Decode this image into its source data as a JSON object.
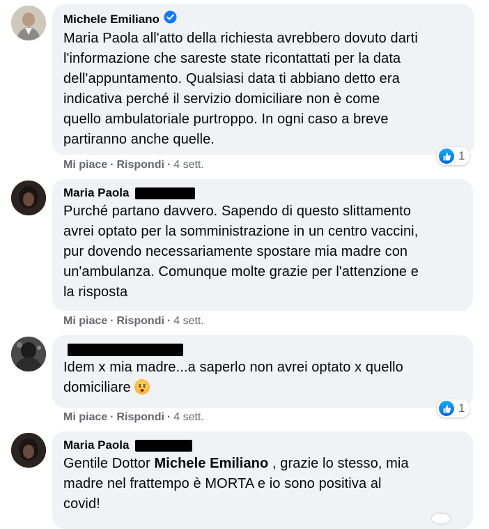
{
  "comments": [
    {
      "author": "Michele Emiliano",
      "verified": true,
      "lines": [
        "Maria Paola all'atto della richiesta avrebbero dovuto darti",
        "l'informazione che sareste state ricontattati per la data",
        "dell'appuntamento. Qualsiasi data ti abbiano detto era",
        "indicativa perché il servizio domiciliare non è come",
        "quello ambulatoriale purtroppo. In ogni caso a breve",
        "partiranno anche quelle."
      ],
      "like_label": "Mi piace",
      "reply_label": "Rispondi",
      "time": "4 sett.",
      "reaction_count": "1"
    },
    {
      "author": "Maria Paola",
      "lines": [
        "Purché partano davvero. Sapendo di questo slittamento",
        "avrei optato per la somministrazione in un centro vaccini,",
        "pur dovendo necessariamente spostare mia madre con",
        "un'ambulanza. Comunque molte grazie per l'attenzione e",
        "la risposta"
      ],
      "like_label": "Mi piace",
      "reply_label": "Rispondi",
      "time": "4 sett."
    },
    {
      "author": "",
      "lines": [
        "Idem x mia madre...a saperlo non avrei optato x quello",
        "domiciliare"
      ],
      "like_label": "Mi piace",
      "reply_label": "Rispondi",
      "time": "4 sett.",
      "reaction_count": "1"
    },
    {
      "author": "Maria Paola",
      "line1_prefix": "Gentile Dottor ",
      "line1_mention": "Michele Emiliano",
      "line1_suffix": " , grazie lo stesso, mia",
      "lines": [
        "madre nel frattempo è MORTA e io sono positiva al",
        "covid!"
      ]
    }
  ],
  "colors": {
    "bubble": "#f0f2f5",
    "meta_text": "#65676b",
    "verified_badge": "#1877f2",
    "like_blue": "#0866ff"
  }
}
